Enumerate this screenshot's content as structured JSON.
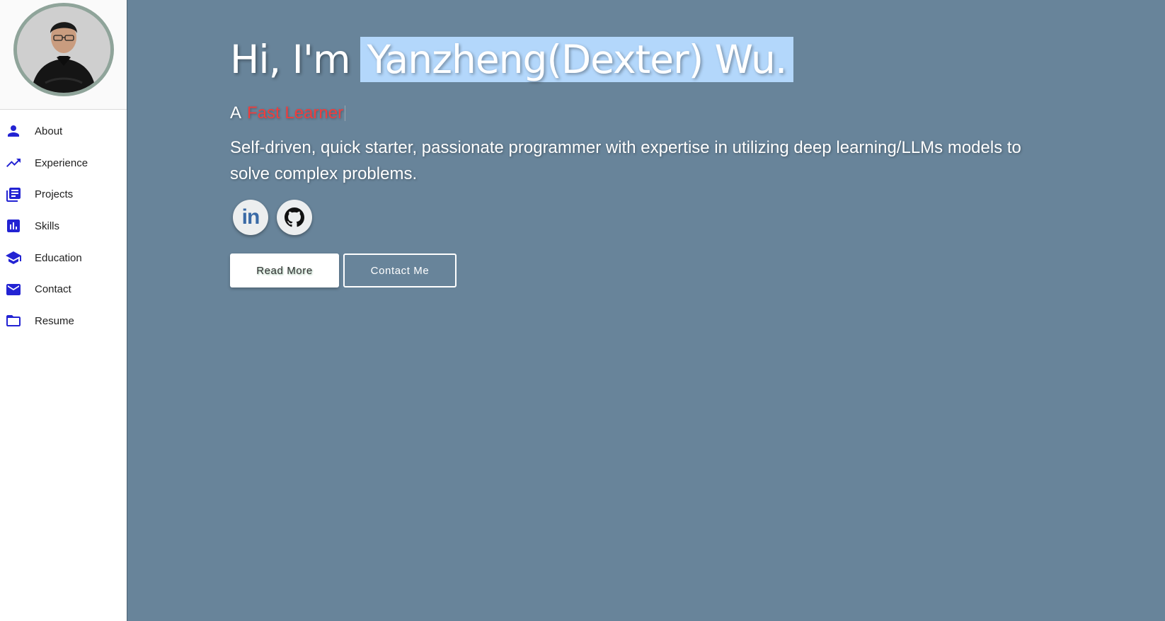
{
  "sidebar": {
    "items": [
      {
        "label": "About",
        "icon": "person-icon"
      },
      {
        "label": "Experience",
        "icon": "trending-up-icon"
      },
      {
        "label": "Projects",
        "icon": "library-books-icon"
      },
      {
        "label": "Skills",
        "icon": "bar-chart-icon"
      },
      {
        "label": "Education",
        "icon": "school-icon"
      },
      {
        "label": "Contact",
        "icon": "mail-icon"
      },
      {
        "label": "Resume",
        "icon": "folder-icon"
      }
    ]
  },
  "hero": {
    "greeting": "Hi, I'm",
    "name": "Yanzheng(Dexter) Wu.",
    "tagline_prefix": "A",
    "tagline_typed": "Fast Learner",
    "bio": "Self-driven, quick starter, passionate programmer with expertise in utilizing deep learning/LLMs models to solve complex problems.",
    "read_more": "Read More",
    "contact_me": "Contact Me",
    "linkedin_text": "in"
  },
  "colors": {
    "accent": "#2323d3",
    "background": "#68849a",
    "highlight": "#b3d7fb",
    "typed_text": "#ef3d3d"
  }
}
